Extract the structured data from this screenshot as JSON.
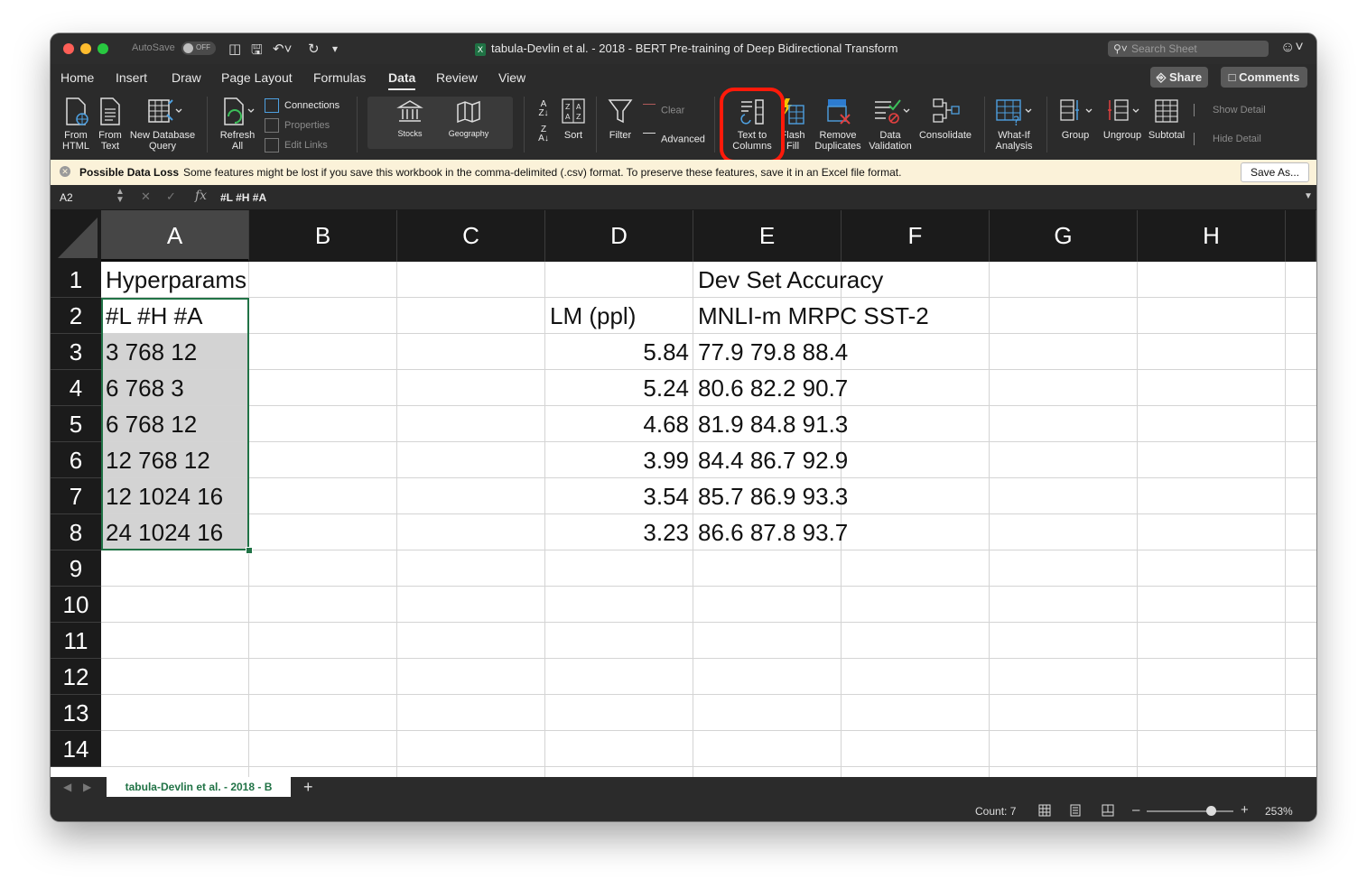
{
  "titlebar": {
    "autosave": "AutoSave",
    "toggle": "OFF",
    "title": "tabula-Devlin et al. - 2018 - BERT Pre-training of Deep Bidirectional Transform",
    "search_placeholder": "Search Sheet"
  },
  "menu": {
    "items": [
      "Home",
      "Insert",
      "Draw",
      "Page Layout",
      "Formulas",
      "Data",
      "Review",
      "View"
    ],
    "active": "Data",
    "share": "Share",
    "comments": "Comments"
  },
  "ribbon": {
    "from_html": [
      "From",
      "HTML"
    ],
    "from_text": [
      "From",
      "Text"
    ],
    "new_db_query": [
      "New Database",
      "Query"
    ],
    "refresh_all": [
      "Refresh",
      "All"
    ],
    "connections": "Connections",
    "properties": "Properties",
    "edit_links": "Edit Links",
    "stocks": "Stocks",
    "geography": "Geography",
    "sort": "Sort",
    "filter": "Filter",
    "clear": "Clear",
    "advanced": "Advanced",
    "text_to_columns": [
      "Text to",
      "Columns"
    ],
    "flash_fill": [
      "Flash",
      "Fill"
    ],
    "remove_duplicates": [
      "Remove",
      "Duplicates"
    ],
    "data_validation": [
      "Data",
      "Validation"
    ],
    "consolidate": "Consolidate",
    "what_if": [
      "What-If",
      "Analysis"
    ],
    "group": "Group",
    "ungroup": "Ungroup",
    "subtotal": "Subtotal",
    "show_detail": "Show Detail",
    "hide_detail": "Hide Detail"
  },
  "message": {
    "title": "Possible Data Loss",
    "text": "Some features might be lost if you save this workbook in the comma-delimited (.csv) format. To preserve these features, save it in an Excel file format.",
    "save_as": "Save As..."
  },
  "formula_bar": {
    "name_box": "A2",
    "fx": "fx",
    "content": "#L #H #A"
  },
  "columns": [
    "A",
    "B",
    "C",
    "D",
    "E",
    "F",
    "G",
    "H"
  ],
  "rows": [
    "1",
    "2",
    "3",
    "4",
    "5",
    "6",
    "7",
    "8",
    "9",
    "10",
    "11",
    "12",
    "13",
    "14"
  ],
  "cells": {
    "A1": "Hyperparams",
    "E1": "Dev Set Accuracy",
    "A2": "#L #H #A",
    "D2": "LM (ppl)",
    "E2": "MNLI-m MRPC SST-2",
    "A3": "3 768 12",
    "D3": "5.84",
    "E3": "77.9 79.8 88.4",
    "A4": "6 768 3",
    "D4": "5.24",
    "E4": "80.6 82.2 90.7",
    "A5": "6 768 12",
    "D5": "4.68",
    "E5": "81.9 84.8 91.3",
    "A6": "12 768 12",
    "D6": "3.99",
    "E6": "84.4 86.7 92.9",
    "A7": "12 1024 16",
    "D7": "3.54",
    "E7": "85.7 86.9 93.3",
    "A8": "24 1024 16",
    "D8": "3.23",
    "E8": "86.6 87.8 93.7"
  },
  "sheet_tab": "tabula-Devlin et al. - 2018 - B",
  "status": {
    "count": "Count: 7",
    "zoom": "253%"
  },
  "colors": {
    "accent_green": "#217346",
    "highlight_red": "#ff1a0a",
    "selection_gray": "#d3d3d3"
  }
}
